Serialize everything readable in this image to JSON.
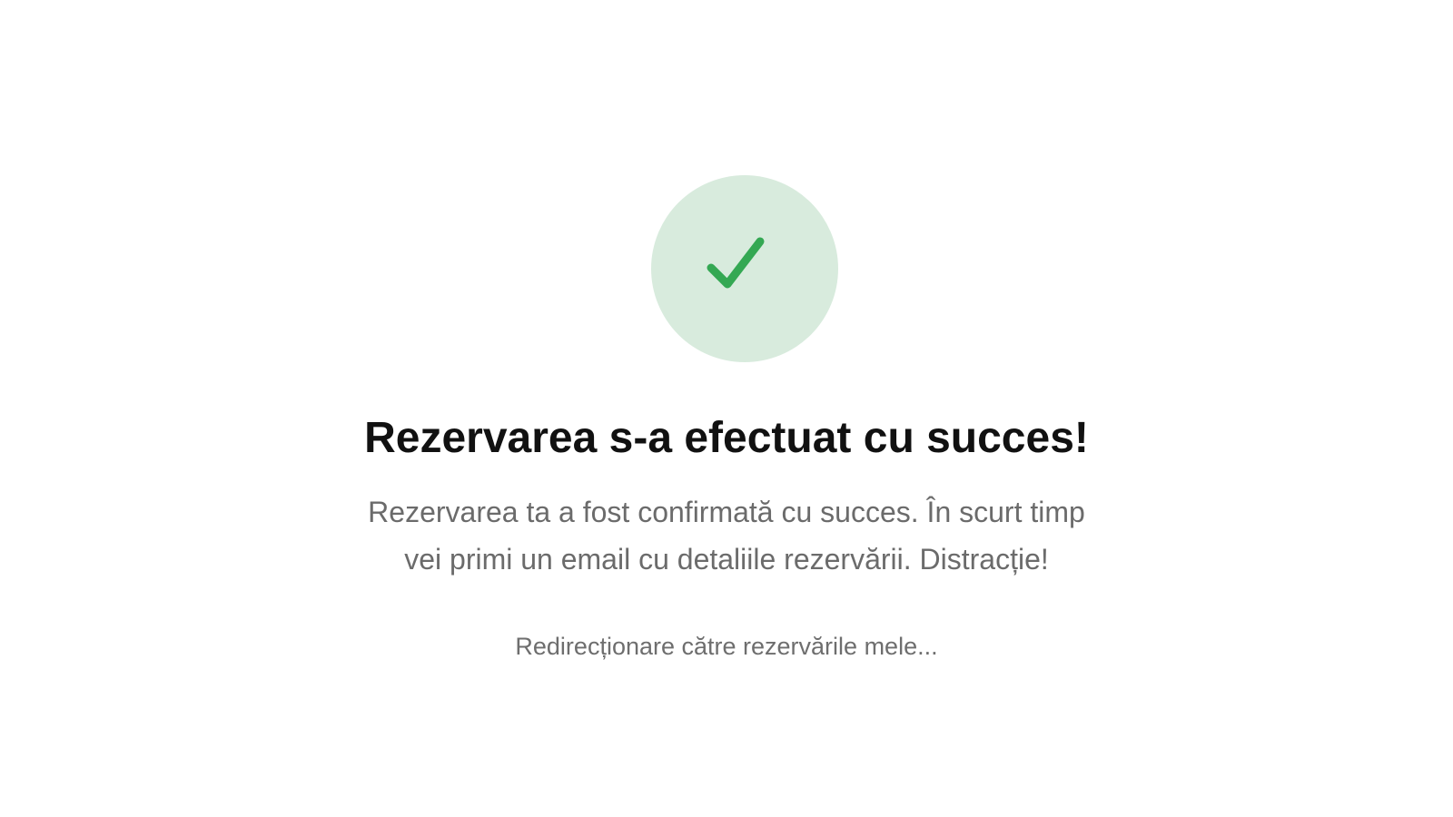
{
  "confirmation": {
    "icon": "check-icon",
    "accent_color": "#34a853",
    "circle_color": "#d8ebdd",
    "title": "Rezervarea s-a efectuat cu succes!",
    "message_line1": "Rezervarea ta a fost confirmată cu succes. În scurt timp",
    "message_line2": "vei primi un email cu detaliile rezervării. Distracție!",
    "redirect_text": "Redirecționare către rezervările mele..."
  }
}
